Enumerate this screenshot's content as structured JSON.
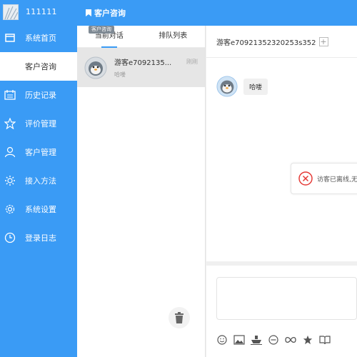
{
  "brand": {
    "name": "111111"
  },
  "sidebar": {
    "items": [
      {
        "label": "系统首页",
        "icon": "home-icon"
      },
      {
        "label": "客户咨询",
        "icon": "",
        "active": true
      },
      {
        "label": "历史记录",
        "icon": "calendar-icon"
      },
      {
        "label": "评价管理",
        "icon": "star-icon"
      },
      {
        "label": "客户管理",
        "icon": "user-icon"
      },
      {
        "label": "接入方法",
        "icon": "gear-icon"
      },
      {
        "label": "系统设置",
        "icon": "cog-icon"
      },
      {
        "label": "登录日志",
        "icon": "clock-icon"
      }
    ]
  },
  "topbar": {
    "title": "客户咨询"
  },
  "tooltip": {
    "text": "客户咨询"
  },
  "tabs": [
    {
      "label": "当前对话",
      "active": true
    },
    {
      "label": "排队列表",
      "active": false
    }
  ],
  "conversation": {
    "name": "游客e7092135...",
    "preview": "哈喽",
    "time": "刚刚"
  },
  "chat": {
    "visitor_id": "游客e70921352320253s352",
    "messages": [
      {
        "text": "哈喽"
      }
    ],
    "notice": "访客已离线,无"
  },
  "colors": {
    "primary": "#3a9bf5",
    "active_bg": "#ffffff",
    "notice_icon": "#e53935"
  }
}
